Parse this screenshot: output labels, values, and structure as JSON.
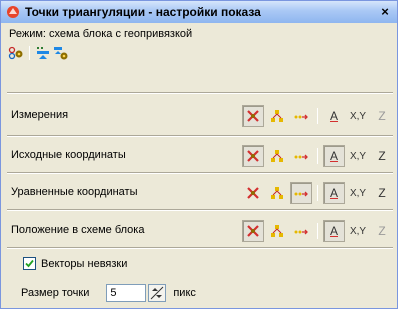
{
  "window": {
    "title": "Точки триангуляции - настройки показа",
    "close_label": "×"
  },
  "mode_label": "Режим: схема блока с геопривязкой",
  "rows": [
    {
      "label": "Измерения",
      "pressed": [
        0
      ],
      "z_dim": true
    },
    {
      "label": "Исходные координаты",
      "pressed": [
        0,
        3
      ],
      "z_dim": false
    },
    {
      "label": "Уравненные координаты",
      "pressed": [
        2,
        3
      ],
      "z_dim": false
    },
    {
      "label": "Положение в схеме блока",
      "pressed": [
        0,
        3
      ],
      "z_dim": true
    }
  ],
  "tools": {
    "a_label": "A",
    "xy_label": "X,Y",
    "z_label": "Z"
  },
  "residual_vectors": {
    "label": "Векторы невязки",
    "checked": true
  },
  "point_size": {
    "label": "Размер точки",
    "value": "5",
    "unit": "пикс"
  },
  "colors": {
    "title_gradient_top": "#d6e5fb",
    "window_bg": "#ece9d8",
    "accent_red": "#d32f2f",
    "accent_yellow": "#e6b800"
  }
}
